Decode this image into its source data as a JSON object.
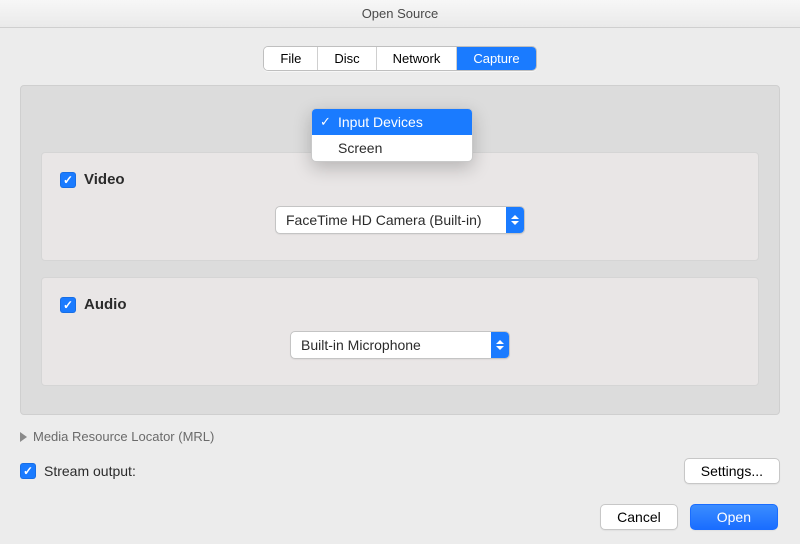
{
  "window": {
    "title": "Open Source"
  },
  "tabs": {
    "file": "File",
    "disc": "Disc",
    "network": "Network",
    "capture": "Capture"
  },
  "captureDropdown": {
    "option1": "Input Devices",
    "option2": "Screen"
  },
  "video": {
    "label": "Video",
    "selected": "FaceTime HD Camera (Built-in)"
  },
  "audio": {
    "label": "Audio",
    "selected": "Built-in Microphone"
  },
  "mrl": {
    "label": "Media Resource Locator (MRL)"
  },
  "stream": {
    "label": "Stream output:"
  },
  "buttons": {
    "settings": "Settings...",
    "cancel": "Cancel",
    "open": "Open"
  }
}
